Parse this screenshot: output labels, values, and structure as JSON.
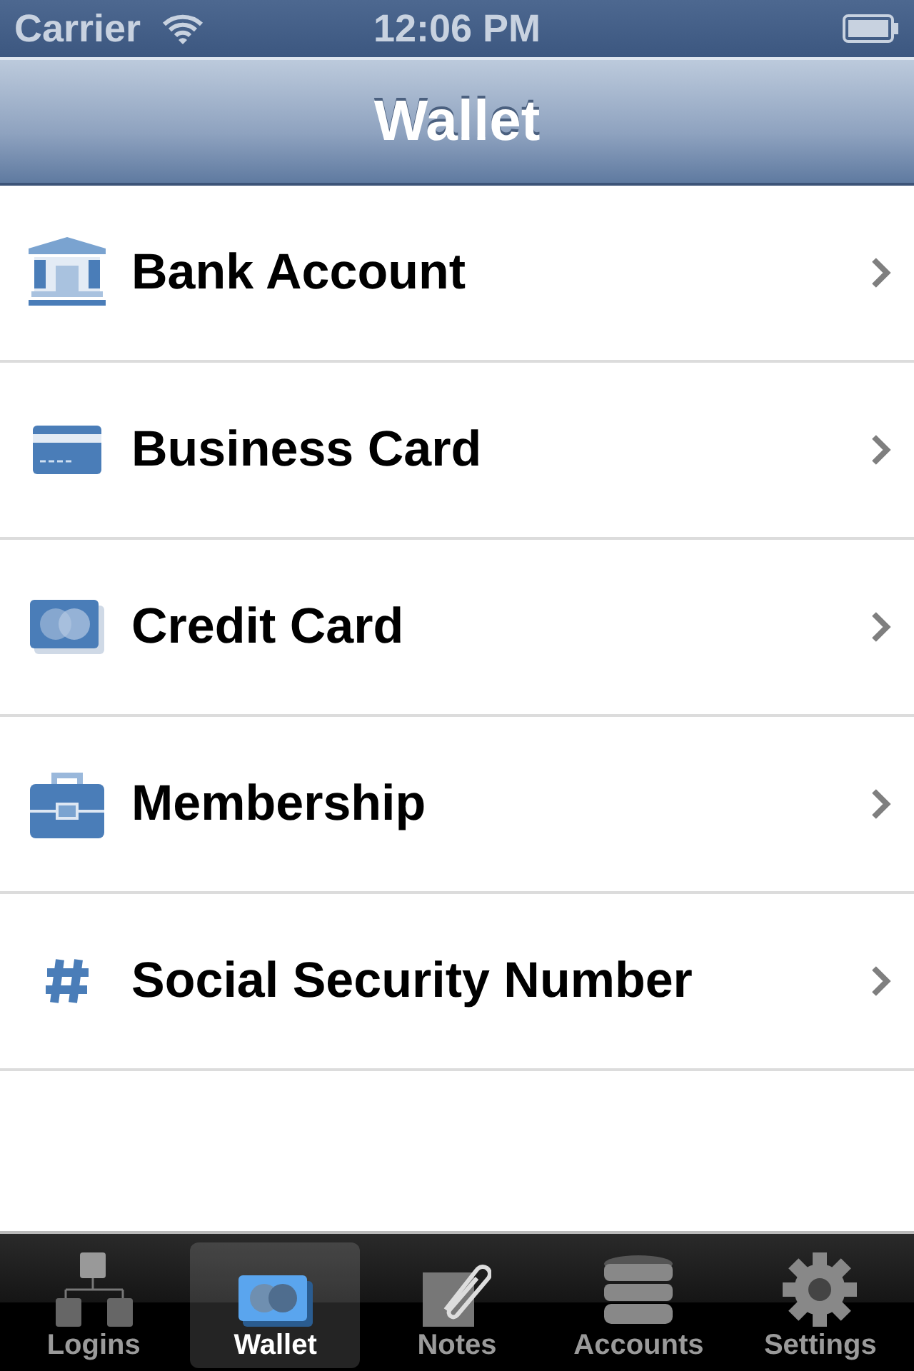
{
  "status_bar": {
    "carrier": "Carrier",
    "time": "12:06 PM"
  },
  "nav_bar": {
    "title": "Wallet"
  },
  "items": [
    {
      "kind": "bank",
      "label": "Bank Account"
    },
    {
      "kind": "business-card",
      "label": "Business Card"
    },
    {
      "kind": "credit-card",
      "label": "Credit Card"
    },
    {
      "kind": "membership",
      "label": "Membership"
    },
    {
      "kind": "number",
      "label": "Social Security Number"
    }
  ],
  "tab_bar": [
    {
      "kind": "logins",
      "label": "Logins",
      "selected": false
    },
    {
      "kind": "wallet",
      "label": "Wallet",
      "selected": true
    },
    {
      "kind": "notes",
      "label": "Notes",
      "selected": false
    },
    {
      "kind": "accounts",
      "label": "Accounts",
      "selected": false
    },
    {
      "kind": "settings",
      "label": "Settings",
      "selected": false
    }
  ]
}
